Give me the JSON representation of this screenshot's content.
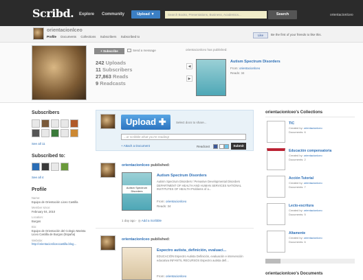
{
  "header": {
    "logo": "Scribd.",
    "nav_explore": "Explore",
    "nav_community": "Community",
    "upload_label": "Upload ▼",
    "search_placeholder": "Search Books, Presentations, Business, Academics...",
    "search_button": "Search",
    "username": "orientacionlceo"
  },
  "profile": {
    "name": "orientacionlceo",
    "tabs": [
      "Profile",
      "Documents",
      "Collections",
      "Subscribers",
      "Subscribed to"
    ],
    "like_button": "Like",
    "like_text": "Be the first of your friends to like this.",
    "subscribe_button": "+ Subscribe",
    "send_message": "Send a message",
    "stats": [
      {
        "value": "242",
        "label": "Uploads"
      },
      {
        "value": "11",
        "label": "Subscribers"
      },
      {
        "value": "27,863",
        "label": "Reads"
      },
      {
        "value": "9",
        "label": "Readcasts"
      }
    ],
    "has_published": "orientacionlceo has published:",
    "featured_doc": {
      "title": "Autism Spectrum Disorders",
      "from_label": "From",
      "from_user": "orientacionlceo",
      "reads_label": "Reads",
      "reads": "34"
    }
  },
  "left": {
    "subscribers_heading": "Subscribers",
    "see_all_subscribers": "See all 11",
    "subscribed_heading": "Subscribed to:",
    "see_all_subscribed": "See all 4",
    "profile_heading": "Profile",
    "fields": [
      {
        "label": "Name:",
        "value": "Equipo de Orientación Liceo Castilla"
      },
      {
        "label": "Member since:",
        "value": "February 04, 2010"
      },
      {
        "label": "Location:",
        "value": "Burgos"
      },
      {
        "label": "Bio:",
        "value": "Equipo de Orientación del Colegio Marista Liceo Castilla de Burgos (España)"
      },
      {
        "label": "Website:",
        "value": "http://orientacionliceocastilla.blog..."
      }
    ]
  },
  "upload": {
    "button": "Upload",
    "select_text": "Select docs to share...",
    "status_placeholder": "...or scribble what you're reading!",
    "attach": "+ Attach a Document",
    "post_to": "Readcast",
    "submit": "Submit"
  },
  "feed": [
    {
      "user": "orientacionlceo",
      "action": "published:",
      "title": "Autism Spectrum Disorders",
      "desc": "Autism Spectrum Disorders / Pervasive Developmental Disorders DEPARTMENT OF HEALTH AND HUMAN SERVICES NATIONAL INSTITUTES OF HEALTH Problems of a...",
      "from_label": "From",
      "from_user": "orientacionlceo",
      "reads_label": "Reads",
      "reads": "34",
      "thumb_text": "Autism Spectrum Disorders",
      "time": "1 day ago",
      "action_link": "Add a Scribble"
    },
    {
      "user": "orientacionlceo",
      "action": "published:",
      "title": "Espectro autista_definición, evaluaci...",
      "desc": "EDUCACIÓN Espectro Autista Definición, evaluación e intervención educativa INFANTIL RECURSOS Espectro autista defi...",
      "from_label": "From",
      "from_user": "orientacionlceo"
    }
  ],
  "collections": {
    "heading": "orientacionlceo's Collections",
    "created_label": "Created by",
    "docs_label": "Documents",
    "items": [
      {
        "title": "TIC",
        "creator": "orientacionlceo",
        "docs": "6"
      },
      {
        "title": "Educación compensatoria",
        "creator": "orientacionlceo",
        "docs": "2"
      },
      {
        "title": "Acción Tutorial",
        "creator": "orientacionlceo",
        "docs": "7"
      },
      {
        "title": "Lecto-escritura",
        "creator": "orientacionlceo",
        "docs": "5"
      },
      {
        "title": "Altamente",
        "creator": "orientacionlceo",
        "docs": "6"
      }
    ],
    "documents_heading": "orientacionlceo's Documents"
  }
}
